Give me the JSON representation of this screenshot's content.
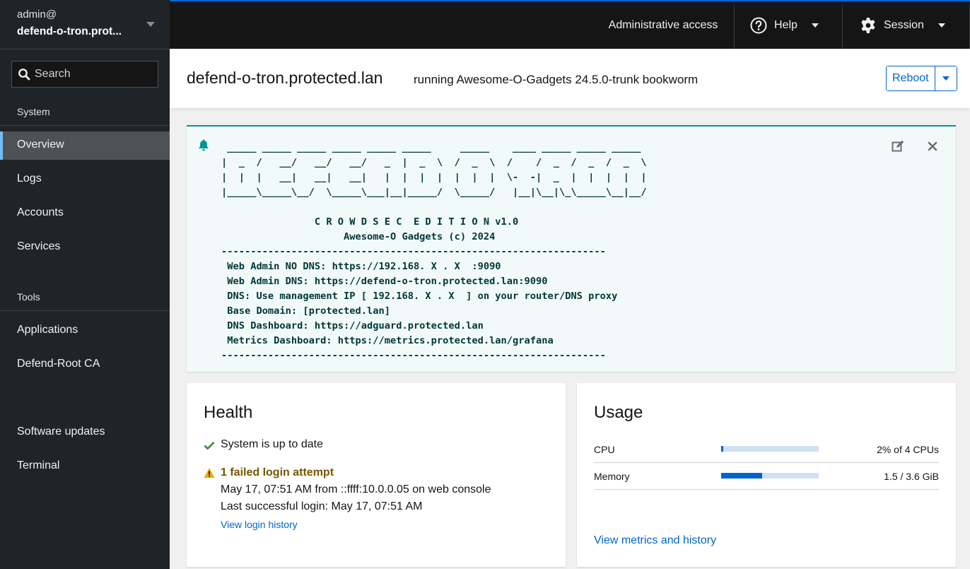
{
  "sidebar": {
    "host": {
      "user": "admin@",
      "name": "defend-o-tron.prot..."
    },
    "search": {
      "placeholder": "Search"
    },
    "sections": [
      {
        "title": "System",
        "items": [
          "Overview",
          "Logs",
          "Accounts",
          "Services"
        ]
      },
      {
        "title": "Tools",
        "items": [
          "Applications",
          "Defend-Root CA"
        ]
      }
    ],
    "bottom_items": [
      "Software updates",
      "Terminal"
    ],
    "active_item": "Overview"
  },
  "topbar": {
    "admin_access": "Administrative access",
    "help": {
      "label": "Help",
      "icon": "help-circle-icon"
    },
    "session": {
      "label": "Session",
      "icon": "gear-icon"
    }
  },
  "header": {
    "title": "defend-o-tron.protected.lan",
    "subtitle": "running Awesome-O-Gadgets 24.5.0-trunk bookworm",
    "reboot_label": "Reboot"
  },
  "motd": {
    "icon": "bell-icon",
    "lines": [
      " _____ _____ _____ _____ _____ _____     _____    ____ _____ _____ _____",
      "|  _  /   __/   __/   __/   _  |  _  \\  /  _  \\  /    /  _  /  _  /  _  \\",
      "|  |  |   __|   __|   __|   |  |  |  |  |  |  |  \\-  -|  _  |  |  |  |  |",
      "|_____\\_____\\__/  \\_____\\___|__|_____/  \\_____/   |__|\\__|\\_\\_____\\__|__/",
      "",
      "                C R O W D S E C  E D I T I O N v1.0",
      "                     Awesome-O Gadgets (c) 2024",
      "------------------------------------------------------------------",
      " Web Admin NO DNS: https://192.168. X . X  :9090",
      " Web Admin DNS: https://defend-o-tron.protected.lan:9090",
      " DNS: Use management IP [ 192.168. X . X  ] on your router/DNS proxy",
      " Base Domain: [protected.lan]",
      " DNS Dashboard: https://adguard.protected.lan",
      " Metrics Dashboard: https://metrics.protected.lan/grafana",
      "------------------------------------------------------------------"
    ]
  },
  "health": {
    "title": "Health",
    "status": "System is up to date",
    "failed_title": "1 failed login attempt",
    "failed_detail": "May 17, 07:51 AM from ::ffff:10.0.0.05 on web console",
    "last_login": "Last successful login: May 17, 07:51 AM",
    "history_link": "View login history"
  },
  "usage": {
    "title": "Usage",
    "rows": [
      {
        "label": "CPU",
        "value": "2% of 4 CPUs",
        "fraction": 0.02
      },
      {
        "label": "Memory",
        "value": "1.5 / 3.6 GiB",
        "fraction": 0.42
      }
    ],
    "metrics_link": "View metrics and history"
  },
  "colors": {
    "accent": "#0066cc",
    "motd_border": "#009596",
    "warning": "#f0ab00",
    "success": "#3e8635",
    "sidebar_bg": "#212427"
  }
}
